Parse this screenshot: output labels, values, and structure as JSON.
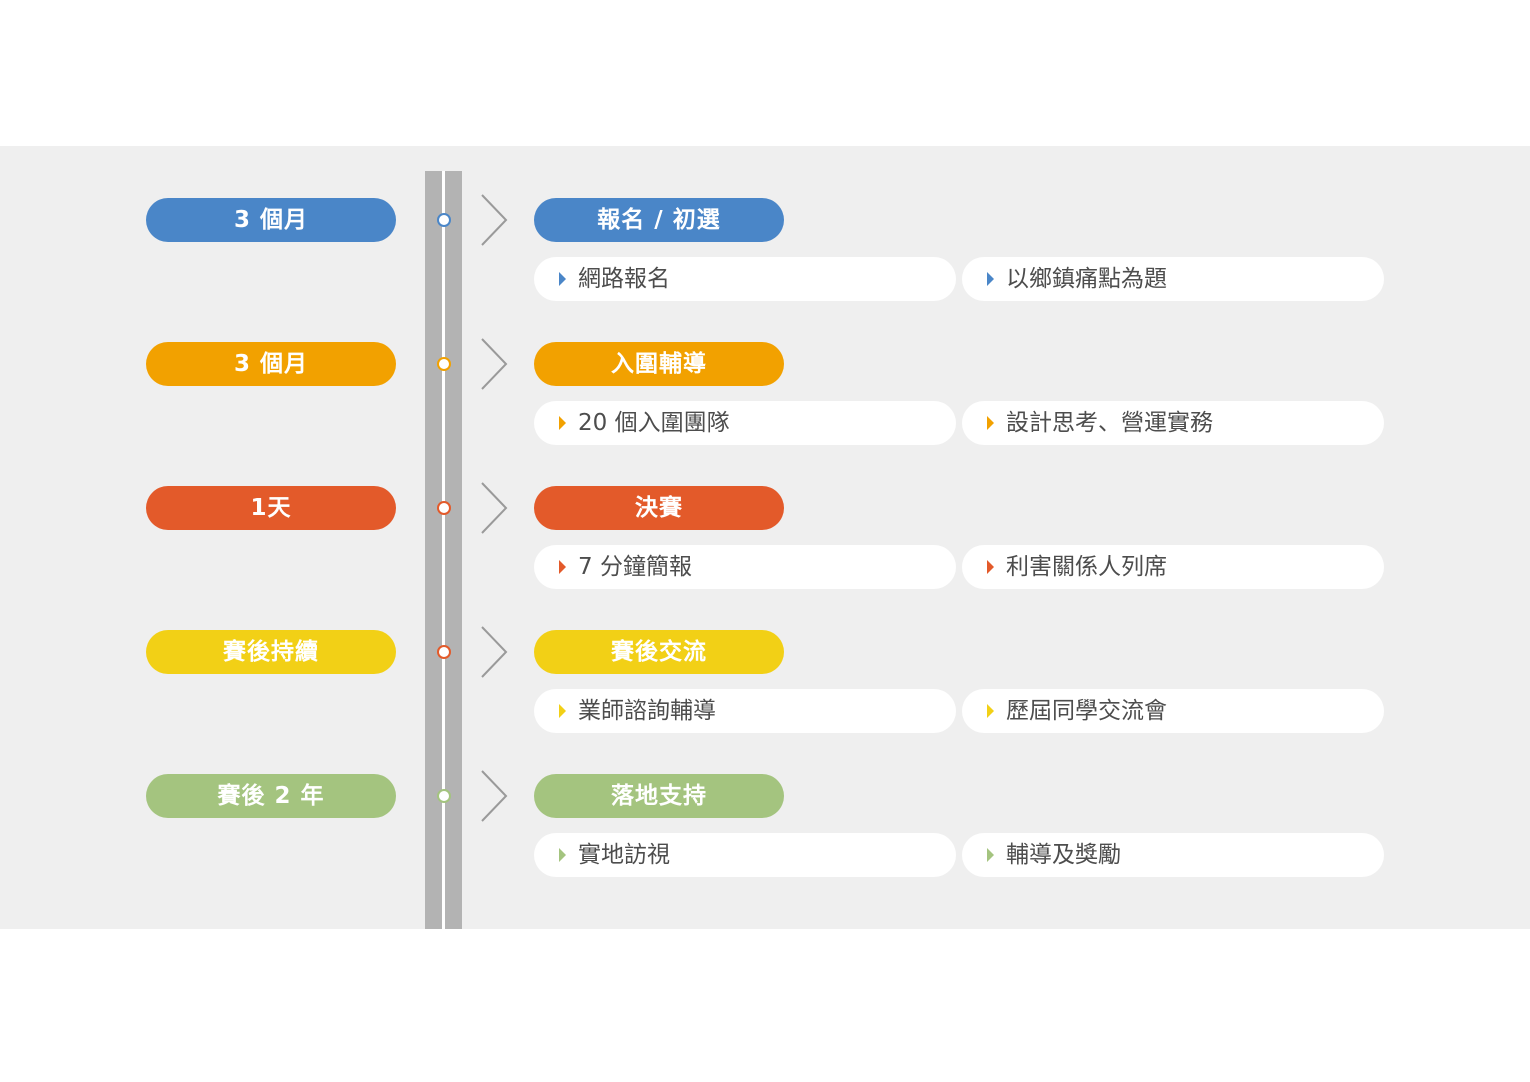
{
  "colors": {
    "blue": "#4a86c8",
    "orange": "#f2a100",
    "red": "#e35a2a",
    "yellow": "#f2d016",
    "green": "#a4c47f",
    "panel": "#efefef",
    "rail": "#b3b3b3",
    "text": "#4d4d4d"
  },
  "stages": [
    {
      "duration": "3 個月",
      "title": "報名 / 初選",
      "color": "#4a86c8",
      "dot_color": "#4a86c8",
      "items": [
        "網路報名",
        "以鄉鎮痛點為題"
      ]
    },
    {
      "duration": "3 個月",
      "title": "入圍輔導",
      "color": "#f2a100",
      "dot_color": "#f2a100",
      "items": [
        "20 個入圍團隊",
        "設計思考、營運實務"
      ]
    },
    {
      "duration": "1天",
      "title": "決賽",
      "color": "#e35a2a",
      "dot_color": "#e35a2a",
      "items": [
        "7 分鐘簡報",
        "利害關係人列席"
      ]
    },
    {
      "duration": "賽後持續",
      "title": "賽後交流",
      "color": "#f2d016",
      "dot_color": "#e35a2a",
      "items": [
        "業師諮詢輔導",
        "歷屆同學交流會"
      ]
    },
    {
      "duration": "賽後 2 年",
      "title": "落地支持",
      "color": "#a4c47f",
      "dot_color": "#a4c47f",
      "items": [
        "實地訪視",
        "輔導及獎勵"
      ]
    }
  ]
}
